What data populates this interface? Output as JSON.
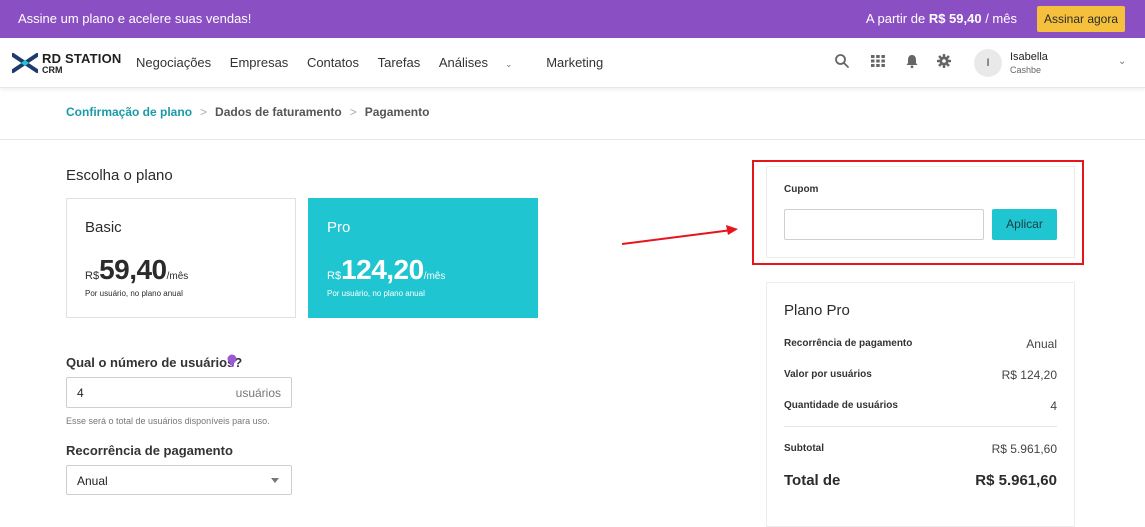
{
  "promo": {
    "message": "Assine um plano e acelere suas vendas!",
    "price_prefix": "A partir de",
    "price": "R$ 59,40",
    "price_suffix": "/ mês",
    "cta": "Assinar agora",
    "background": "#8b4fc4",
    "cta_color": "#f5c03b"
  },
  "nav": {
    "brand": "RD STATION",
    "brand_sub": "CRM",
    "items": [
      {
        "label": "Negociações"
      },
      {
        "label": "Empresas"
      },
      {
        "label": "Contatos"
      },
      {
        "label": "Tarefas"
      },
      {
        "label": "Análises"
      },
      {
        "label": "Marketing"
      }
    ],
    "icons": [
      "search-icon",
      "apps-grid-icon",
      "bell-icon",
      "gear-icon"
    ],
    "user": {
      "initial": "I",
      "name": "Isabella",
      "company": "Cashbe"
    }
  },
  "breadcrumb": {
    "items": [
      "Confirmação de plano",
      "Dados de faturamento",
      "Pagamento"
    ],
    "active_color": "#1a9aa8"
  },
  "plans": {
    "heading": "Escolha o plano",
    "basic": {
      "name": "Basic",
      "currency": "R$",
      "amount": "59,40",
      "period": "/mês",
      "note": "Por usuário, no plano anual"
    },
    "pro": {
      "name": "Pro",
      "currency": "R$",
      "amount": "124,20",
      "period": "/mês",
      "note": "Por usuário, no plano anual"
    },
    "selected_color": "#1fc6d1"
  },
  "users": {
    "heading": "Qual o número de usuários?",
    "value": "4",
    "suffix": "usuários",
    "help": "Esse será o total de usuários disponíveis para uso."
  },
  "recurrence": {
    "heading": "Recorrência de pagamento",
    "selected": "Anual"
  },
  "coupon": {
    "label": "Cupom",
    "value": "",
    "apply": "Aplicar",
    "highlight_color": "#e8141b"
  },
  "summary": {
    "title": "Plano Pro",
    "rows": [
      {
        "label": "Recorrência de pagamento",
        "value": "Anual"
      },
      {
        "label": "Valor por usuários",
        "value": "R$ 124,20"
      },
      {
        "label": "Quantidade de usuários",
        "value": "4"
      }
    ],
    "subtotal_label": "Subtotal",
    "subtotal": "R$ 5.961,60",
    "total_label": "Total de",
    "total": "R$ 5.961,60"
  }
}
